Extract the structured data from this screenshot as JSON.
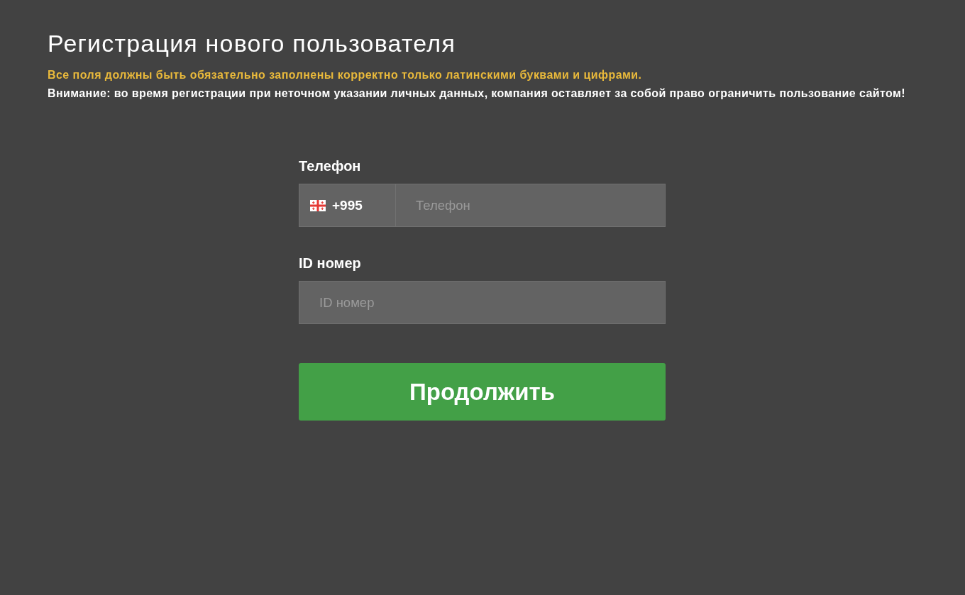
{
  "page": {
    "title": "Регистрация нового пользователя",
    "notice": "Все поля должны быть обязательно заполнены корректно только латинскими буквами и цифрами.",
    "warning": "Внимание: во время регистрации при неточном указании личных данных, компания оставляет за собой право ограничить пользование сайтом!"
  },
  "form": {
    "fields": [
      {
        "kind": "phone",
        "label": "Телефон",
        "country_code": "+995",
        "placeholder": "Телефон"
      },
      {
        "kind": "text",
        "label": "ID номер",
        "placeholder": "ID номер"
      }
    ],
    "submit": {
      "label": "Продолжить"
    }
  }
}
